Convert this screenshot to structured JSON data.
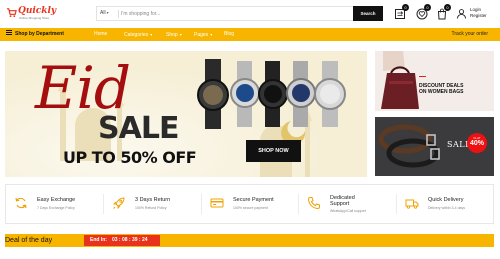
{
  "header": {
    "logo_text": "Quickly",
    "logo_tagline": "Online Shopping Store",
    "search": {
      "category": "All",
      "placeholder": "I'm shopping for...",
      "button_label": "Search"
    },
    "icons": [
      {
        "name": "compare-icon",
        "badge": "0"
      },
      {
        "name": "wishlist-icon",
        "badge": "0"
      },
      {
        "name": "cart-icon",
        "badge": "0"
      }
    ],
    "account": {
      "line1": "Login",
      "line2": "Register"
    }
  },
  "nav": {
    "department_label": "Shop by Department",
    "items": [
      {
        "label": "Home",
        "dropdown": false
      },
      {
        "label": "Categories",
        "dropdown": true
      },
      {
        "label": "Shop",
        "dropdown": true
      },
      {
        "label": "Pages",
        "dropdown": true
      },
      {
        "label": "Blog",
        "dropdown": false
      }
    ],
    "track_label": "Track your order"
  },
  "hero": {
    "headline": "Eid",
    "sale": "SALE",
    "offer": "UP TO 50% OFF",
    "cta": "SHOP NOW"
  },
  "side_banner_top": {
    "line1": "DISCOUNT DEALS",
    "line2": "ON WOMEN BAGS"
  },
  "side_banner_bottom": {
    "sale": "SALE",
    "flat": "FLAT",
    "percent": "40%"
  },
  "features": [
    {
      "icon": "refresh-icon",
      "title": "Easy Exchange",
      "subtitle": "7 Days Exchange Policy"
    },
    {
      "icon": "rocket-icon",
      "title": "3 Days Return",
      "subtitle": "100% Refund Policy"
    },
    {
      "icon": "credit-card-icon",
      "title": "Secure Payment",
      "subtitle": "100% secure payment"
    },
    {
      "icon": "phone-icon",
      "title": "Dedicated\nSupport",
      "title_line1": "Dedicated",
      "title_line2": "Support",
      "subtitle": "WhatsApp/Call support"
    },
    {
      "icon": "truck-icon",
      "title": "Quick Delivery",
      "subtitle": "Delivery within 3-4 days"
    }
  ],
  "deal": {
    "label": "Deal of the day",
    "ends_in": "End In:",
    "time": "03 : 08 : 39 : 24"
  },
  "colors": {
    "accent": "#f7b500",
    "brand_red": "#e5331d",
    "timer_red": "#e8321c",
    "dark": "#111111"
  }
}
